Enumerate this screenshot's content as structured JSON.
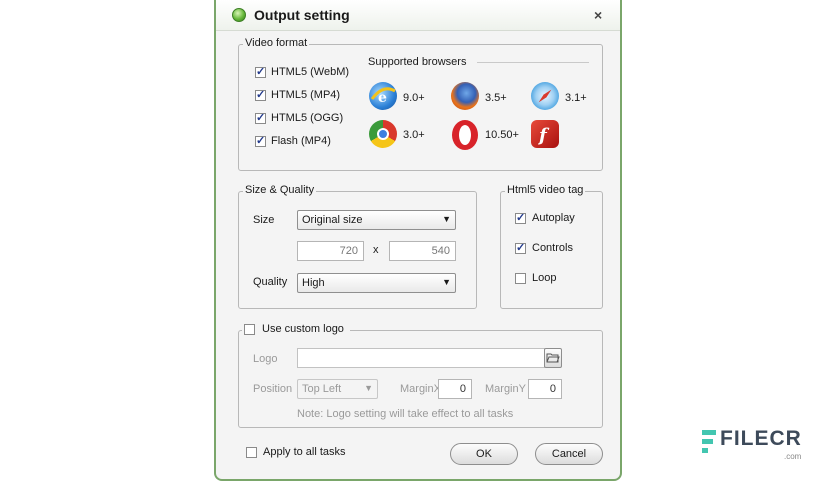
{
  "dialog": {
    "title": "Output setting",
    "close_glyph": "×"
  },
  "video_format": {
    "legend": "Video format",
    "options": [
      {
        "label": "HTML5 (WebM)",
        "checked": true
      },
      {
        "label": "HTML5 (MP4)",
        "checked": true
      },
      {
        "label": "HTML5 (OGG)",
        "checked": true
      },
      {
        "label": "Flash (MP4)",
        "checked": true
      }
    ],
    "browsers_title": "Supported browsers",
    "browsers": [
      {
        "name": "ie-icon",
        "version": "9.0+",
        "color": "#2a7fd6"
      },
      {
        "name": "firefox-icon",
        "version": "3.5+",
        "color": "#e8731c"
      },
      {
        "name": "safari-icon",
        "version": "3.1+",
        "color": "#4aa3e0"
      },
      {
        "name": "chrome-icon",
        "version": "3.0+",
        "color": "#3b9a3b"
      },
      {
        "name": "opera-icon",
        "version": "10.50+",
        "color": "#d8232a"
      },
      {
        "name": "flash-icon",
        "version": "",
        "color": "#c41a1a"
      }
    ]
  },
  "size_quality": {
    "legend": "Size & Quality",
    "size_label": "Size",
    "size_value": "Original size",
    "width": "720",
    "times": "x",
    "height": "540",
    "quality_label": "Quality",
    "quality_value": "High"
  },
  "html5_tag": {
    "legend": "Html5 video tag",
    "options": [
      {
        "label": "Autoplay",
        "checked": true
      },
      {
        "label": "Controls",
        "checked": true
      },
      {
        "label": "Loop",
        "checked": false
      }
    ]
  },
  "custom_logo": {
    "legend": "Use custom logo",
    "checked": false,
    "logo_label": "Logo",
    "logo_value": "",
    "position_label": "Position",
    "position_value": "Top Left",
    "marginx_label": "MarginX",
    "marginx_value": "0",
    "marginy_label": "MarginY",
    "marginy_value": "0",
    "note": "Note: Logo setting will take effect to all tasks"
  },
  "footer": {
    "apply_all_label": "Apply to all tasks",
    "apply_all_checked": false,
    "ok_label": "OK",
    "cancel_label": "Cancel"
  },
  "watermark": {
    "brand": "FILECR",
    "suffix": ".com"
  },
  "colors": {
    "frame": "#7aa66a",
    "check": "#233a8c"
  }
}
